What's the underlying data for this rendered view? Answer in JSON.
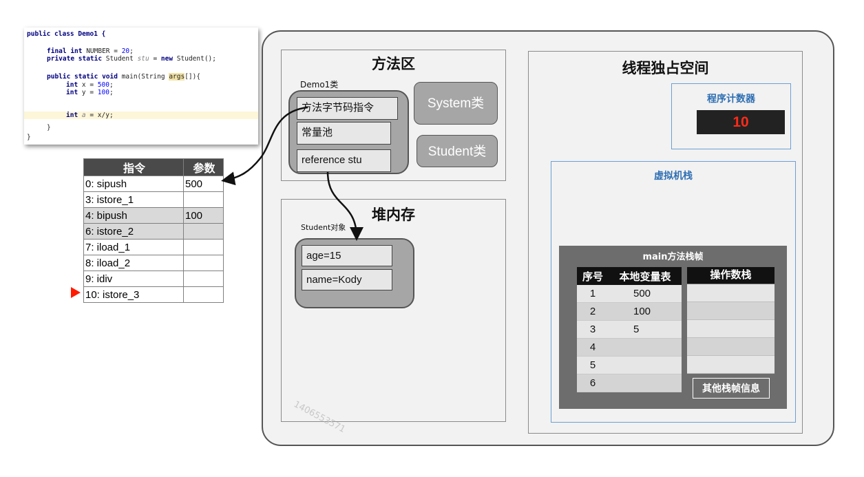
{
  "code": {
    "class_decl": "public class Demo1 {",
    "l1_kw": "final int",
    "l1_rest": " NUMBER = ",
    "l1_num": "20",
    "l1_end": ";",
    "l2_kw1": "private static",
    "l2_mid": " Student ",
    "l2_var": "stu",
    "l2_eq": " = ",
    "l2_kw2": "new",
    "l2_end": " Student();",
    "l3_kw": "public static void",
    "l3_mid": " main(String ",
    "l3_args": "args",
    "l3_end": "[]){",
    "l4_kw": "int",
    "l4_rest": " x = ",
    "l4_num": "500",
    "l4_end": ";",
    "l5_kw": "int",
    "l5_rest": " y = ",
    "l5_num": "100",
    "l5_end": ";",
    "l6_kw": "int",
    "l6_var": "a",
    "l6_rest": " = x/y;",
    "close1": "}",
    "close2": "}"
  },
  "instructions": {
    "headers": [
      "指令",
      "参数"
    ],
    "rows": [
      {
        "op": "0: sipush",
        "arg": "500",
        "grey": false
      },
      {
        "op": "3: istore_1",
        "arg": "",
        "grey": false
      },
      {
        "op": "4: bipush",
        "arg": "100",
        "grey": true
      },
      {
        "op": "6: istore_2",
        "arg": "",
        "grey": true
      },
      {
        "op": "7: iload_1",
        "arg": "",
        "grey": false
      },
      {
        "op": "8: iload_2",
        "arg": "",
        "grey": false
      },
      {
        "op": "9: idiv",
        "arg": "",
        "grey": false
      },
      {
        "op": "10: istore_3",
        "arg": "",
        "grey": false
      }
    ],
    "current_row": 7
  },
  "method_area": {
    "title": "方法区",
    "class_label": "Demo1类",
    "items": [
      "方法字节码指令",
      "常量池",
      "reference stu"
    ],
    "system_label": "System类",
    "student_label": "Student类"
  },
  "heap": {
    "title": "堆内存",
    "object_label": "Student对象",
    "fields": [
      "age=15",
      "name=Kody"
    ]
  },
  "thread": {
    "title": "线程独占空间",
    "pc_title": "程序计数器",
    "pc_value": "10",
    "stack_title": "虚拟机栈",
    "frame_title": "main方法栈帧",
    "lv_headers": [
      "序号",
      "本地变量表"
    ],
    "lv_rows": [
      {
        "idx": "1",
        "val": "500"
      },
      {
        "idx": "2",
        "val": "100"
      },
      {
        "idx": "3",
        "val": "5"
      },
      {
        "idx": "4",
        "val": ""
      },
      {
        "idx": "5",
        "val": ""
      },
      {
        "idx": "6",
        "val": ""
      }
    ],
    "operand_title": "操作数栈",
    "other_info": "其他栈帧信息"
  },
  "watermark": "1406553571",
  "colors": {
    "pc_bg": "#222222",
    "pc_text": "#ff2b1a",
    "pointer": "#ff1a00"
  }
}
